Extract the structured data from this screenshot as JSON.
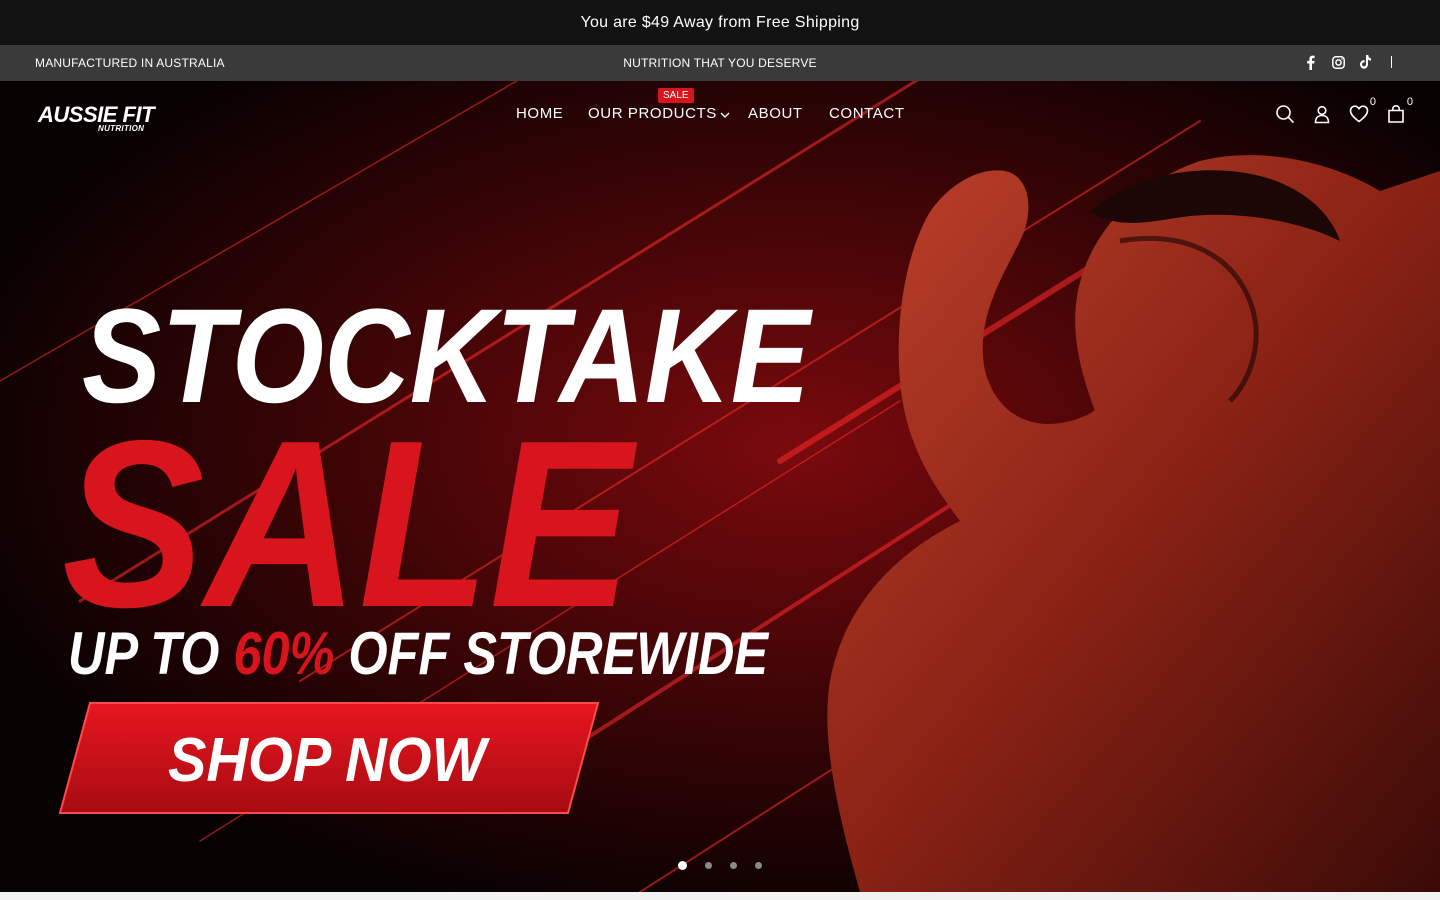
{
  "announcement": {
    "text": "You are $49 Away from Free Shipping"
  },
  "topbar": {
    "left_text": "MANUFACTURED IN AUSTRALIA",
    "center_text": "NUTRITION THAT YOU DESERVE",
    "social_icons": [
      "facebook-icon",
      "instagram-icon",
      "tiktok-icon"
    ],
    "separator": "|"
  },
  "header": {
    "logo": {
      "word": "AUSSIE FIT",
      "sub": "NUTRITION"
    },
    "nav": {
      "home": "HOME",
      "products": "OUR PRODUCTS",
      "products_badge": "SALE",
      "about": "ABOUT",
      "contact": "CONTACT"
    },
    "icons": {
      "search": "search-icon",
      "account": "user-icon",
      "wishlist_count": "0",
      "cart_count": "0"
    }
  },
  "hero": {
    "headline_1": "STOCKTAKE",
    "headline_2": "SALE",
    "offer_prefix": "UP TO ",
    "offer_percent": "60%",
    "offer_suffix": " OFF STOREWIDE",
    "cta": "SHOP NOW",
    "accent_color": "#d8141d",
    "slides_total": 4,
    "active_slide": 1
  }
}
